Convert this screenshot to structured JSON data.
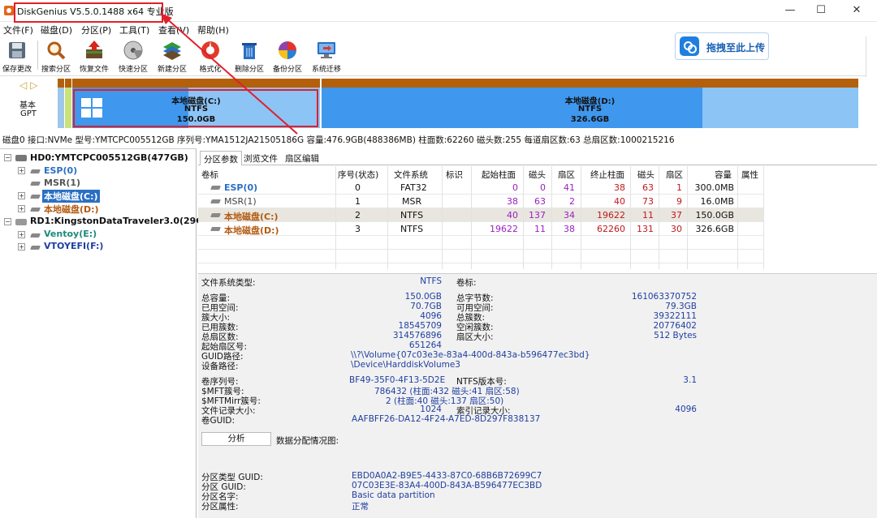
{
  "window": {
    "title": "DiskGenius V5.5.0.1488 x64 专业版",
    "minimize": "—",
    "maximize": "☐",
    "close": "✕"
  },
  "menu": [
    "文件(F)",
    "磁盘(D)",
    "分区(P)",
    "工具(T)",
    "查看(V)",
    "帮助(H)"
  ],
  "toolbar": [
    {
      "label": "保存更改",
      "icon": "save-icon"
    },
    {
      "label": "搜索分区",
      "icon": "search-icon"
    },
    {
      "label": "恢复文件",
      "icon": "recover-icon"
    },
    {
      "label": "快速分区",
      "icon": "disk-icon"
    },
    {
      "label": "新建分区",
      "icon": "layers-icon"
    },
    {
      "label": "格式化",
      "icon": "format-icon"
    },
    {
      "label": "删除分区",
      "icon": "trash-icon"
    },
    {
      "label": "备份分区",
      "icon": "backup-icon"
    },
    {
      "label": "系统迁移",
      "icon": "monitor-icon"
    }
  ],
  "upload": {
    "label": "拖拽至此上传"
  },
  "diskbar": {
    "basic": "基本",
    "gpt": "GPT",
    "c": {
      "name": "本地磁盘(C:)",
      "fs": "NTFS",
      "size": "150.0GB",
      "used": 0.47
    },
    "d": {
      "name": "本地磁盘(D:)",
      "fs": "NTFS",
      "size": "326.6GB",
      "used": 0.71
    }
  },
  "disk_info": "磁盘0 接口:NVMe  型号:YMTCPC005512GB  序列号:YMA1512JA21505186G  容量:476.9GB(488386MB)  柱面数:62260  磁头数:255  每道扇区数:63  总扇区数:1000215216",
  "tree": {
    "hd0": "HD0:YMTCPC005512GB(477GB)",
    "esp": "ESP(0)",
    "msr": "MSR(1)",
    "c": "本地磁盘(C:)",
    "d": "本地磁盘(D:)",
    "rd1": "RD1:KingstonDataTraveler3.0(29GB)",
    "ventoy": "Ventoy(E:)",
    "vtoyefi": "VTOYEFI(F:)"
  },
  "tabs": [
    "分区参数",
    "浏览文件",
    "扇区编辑"
  ],
  "table": {
    "headers": [
      "卷标",
      "序号(状态)",
      "文件系统",
      "标识",
      "起始柱面",
      "磁头",
      "扇区",
      "终止柱面",
      "磁头",
      "扇区",
      "容量",
      "属性"
    ],
    "rows": [
      {
        "label": "ESP(0)",
        "idx": "0",
        "fs": "FAT32",
        "sc": "0",
        "sh": "0",
        "ss": "41",
        "ec": "38",
        "eh": "63",
        "es": "1",
        "cap": "300.0MB"
      },
      {
        "label": "MSR(1)",
        "idx": "1",
        "fs": "MSR",
        "sc": "38",
        "sh": "63",
        "ss": "2",
        "ec": "40",
        "eh": "73",
        "es": "9",
        "cap": "16.0MB"
      },
      {
        "label": "本地磁盘(C:)",
        "idx": "2",
        "fs": "NTFS",
        "sc": "40",
        "sh": "137",
        "ss": "34",
        "ec": "19622",
        "eh": "11",
        "es": "37",
        "cap": "150.0GB"
      },
      {
        "label": "本地磁盘(D:)",
        "idx": "3",
        "fs": "NTFS",
        "sc": "19622",
        "sh": "11",
        "ss": "38",
        "ec": "62260",
        "eh": "131",
        "es": "30",
        "cap": "326.6GB"
      }
    ]
  },
  "details": {
    "fs_type_label": "文件系统类型:",
    "fs_type": "NTFS",
    "vol_label": "卷标:",
    "total_label": "总容量:",
    "total": "150.0GB",
    "total_bytes_label": "总字节数:",
    "total_bytes": "161063370752",
    "used_label": "已用空间:",
    "used": "70.7GB",
    "free_label": "可用空间:",
    "free": "79.3GB",
    "cluster_label": "簇大小:",
    "cluster": "4096",
    "total_clusters_label": "总簇数:",
    "total_clusters": "39322111",
    "used_clusters_label": "已用簇数:",
    "used_clusters": "18545709",
    "free_clusters_label": "空闲簇数:",
    "free_clusters": "20776402",
    "total_sectors_label": "总扇区数:",
    "total_sectors": "314576896",
    "sector_size_label": "扇区大小:",
    "sector_size": "512 Bytes",
    "start_sector_label": "起始扇区号:",
    "start_sector": "651264",
    "guid_path_label": "GUID路径:",
    "guid_path": "\\\\?\\Volume{07c03e3e-83a4-400d-843a-b596477ec3bd}",
    "device_path_label": "设备路径:",
    "device_path": "\\Device\\HarddiskVolume3",
    "serial_label": "卷序列号:",
    "serial": "BF49-35F0-4F13-5D2E",
    "ntfs_ver_label": "NTFS版本号:",
    "ntfs_ver": "3.1",
    "mft_label": "$MFT簇号:",
    "mft": "786432 (柱面:432 磁头:41 扇区:58)",
    "mftmirr_label": "$MFTMirr簇号:",
    "mftmirr": "2 (柱面:40 磁头:137 扇区:50)",
    "record_label": "文件记录大小:",
    "record": "1024",
    "index_label": "索引记录大小:",
    "index": "4096",
    "vol_guid_label": "卷GUID:",
    "vol_guid": "AAFBFF26-DA12-4F24-A7ED-8D297F838137",
    "analyze": "分析",
    "dist": "数据分配情况图:",
    "type_guid_label": "分区类型 GUID:",
    "type_guid": "EBD0A0A2-B9E5-4433-87C0-68B6B72699C7",
    "part_guid_label": "分区 GUID:",
    "part_guid": "07C03E3E-83A4-400D-843A-B596477EC3BD",
    "part_name_label": "分区名字:",
    "part_name": "Basic data partition",
    "part_attr_label": "分区属性:",
    "part_attr": "正常"
  }
}
